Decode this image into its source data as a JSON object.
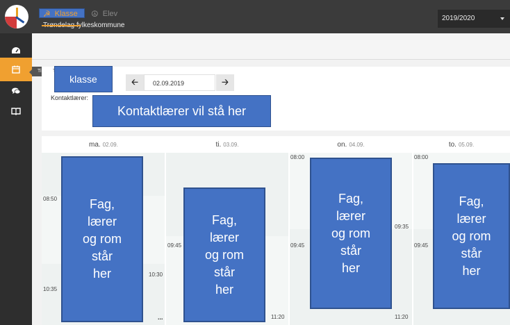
{
  "header": {
    "org_name": "Trøndelag fylkeskommune",
    "year": "2019/2020"
  },
  "sidebar": {
    "items": [
      {
        "icon": "dashboard-icon"
      },
      {
        "icon": "calendar-icon",
        "active": true,
        "tooltip": "Time"
      },
      {
        "icon": "chat-icon"
      },
      {
        "icon": "book-icon"
      }
    ]
  },
  "tabs": [
    {
      "label": "Klasse",
      "active": true
    },
    {
      "label": "Elev",
      "active": false
    }
  ],
  "filter": {
    "class_label": "klasse",
    "date": "02.09.2019",
    "contact_label": "Kontaktlærer:",
    "contact_value": "Kontaktlærer vil stå her"
  },
  "calendar": {
    "days": [
      {
        "name": "ma.",
        "date": "02.09."
      },
      {
        "name": "ti.",
        "date": "03.09."
      },
      {
        "name": "on.",
        "date": "04.09."
      },
      {
        "name": "to.",
        "date": "05.09."
      }
    ],
    "event_text": "Fag,\nlærer\nog rom\nstår\nher",
    "times": {
      "mon_1": "08:50",
      "mon_2": "10:35",
      "mon_3": "10:30",
      "tue_1": "09:45",
      "tue_2": "11:20",
      "wed_1": "08:00",
      "wed_2": "09:45",
      "wed_3": "09:35",
      "wed_4": "11:20",
      "thu_1": "08:00",
      "thu_2": "09:45"
    },
    "more": "..."
  },
  "colors": {
    "accent": "#f0a030",
    "overlay": "#4472c4",
    "topbar": "#3b3b3b"
  }
}
